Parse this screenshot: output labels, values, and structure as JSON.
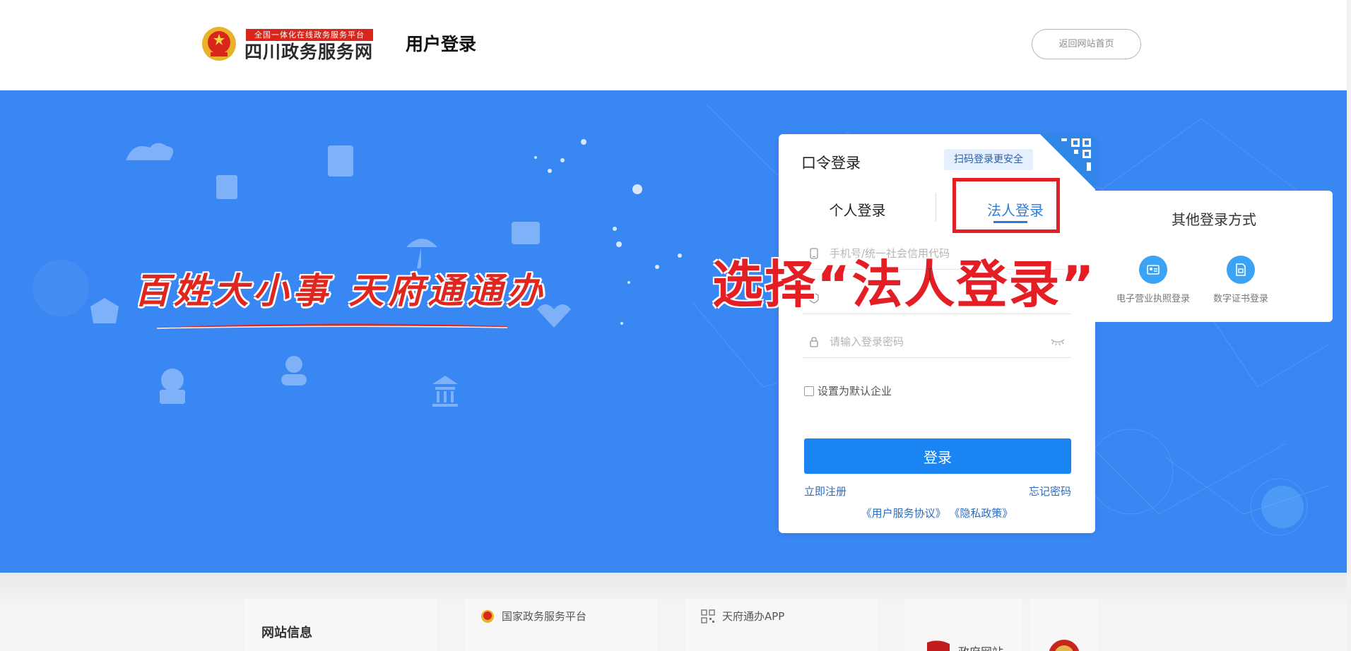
{
  "header": {
    "logo_slogan": "全国一体化在线政务服务平台",
    "logo_name": "四川政务服务网",
    "page_title": "用户登录",
    "home_button": "返回网站首页"
  },
  "banner": {
    "slogan": "百姓大小事 天府通通办"
  },
  "login": {
    "title": "口令登录",
    "qr_tip": "扫码登录更安全",
    "tabs": [
      {
        "label": "个人登录",
        "active": false
      },
      {
        "label": "法人登录",
        "active": true
      }
    ],
    "account_placeholder": "手机号/统一社会信用代码",
    "captcha_placeholder": "",
    "password_placeholder": "请输入登录密码",
    "remember_label": "设置为默认企业",
    "submit_label": "登录",
    "register_link": "立即注册",
    "forgot_link": "忘记密码",
    "agreement_user": "《用户服务协议》",
    "agreement_privacy": "《隐私政策》"
  },
  "other_methods": {
    "title": "其他登录方式",
    "items": [
      {
        "label": "电子营业执照登录",
        "icon": "business-license-icon"
      },
      {
        "label": "数字证书登录",
        "icon": "digital-certificate-icon"
      }
    ]
  },
  "annotation": {
    "text": "选择“法人登录”"
  },
  "footer": {
    "site_info": "网站信息",
    "national_platform": "国家政务服务平台",
    "app": "天府通办APP",
    "gov_site": "政府网站"
  },
  "colors": {
    "banner_blue": "#3987f3",
    "primary_button": "#1a85f2",
    "link": "#2b6cc0",
    "annotation_red": "#e31e24"
  }
}
